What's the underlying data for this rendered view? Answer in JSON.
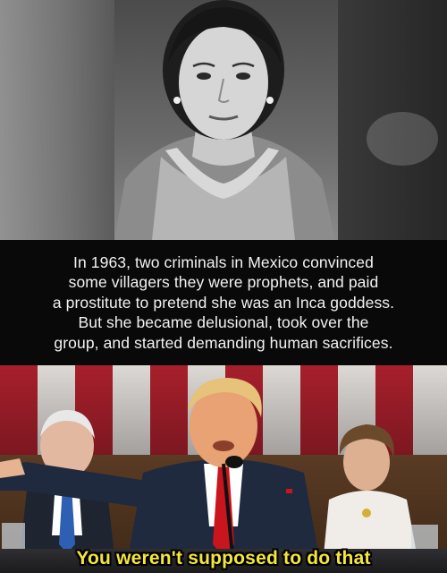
{
  "caption": {
    "lines": [
      "In 1963, two criminals in Mexico convinced",
      "some villagers they were prophets, and paid",
      "a prostitute to pretend she was an Inca goddess.",
      "But she became delusional, took over the",
      "group, and started demanding human sacrifices."
    ]
  },
  "meme": {
    "subtitle": "You weren't supposed to do that"
  },
  "colors": {
    "subtitle_yellow": "#f5e63c",
    "flag_red": "#b0212e",
    "flag_white": "#e8e4e0",
    "caption_bg": "#090909"
  }
}
